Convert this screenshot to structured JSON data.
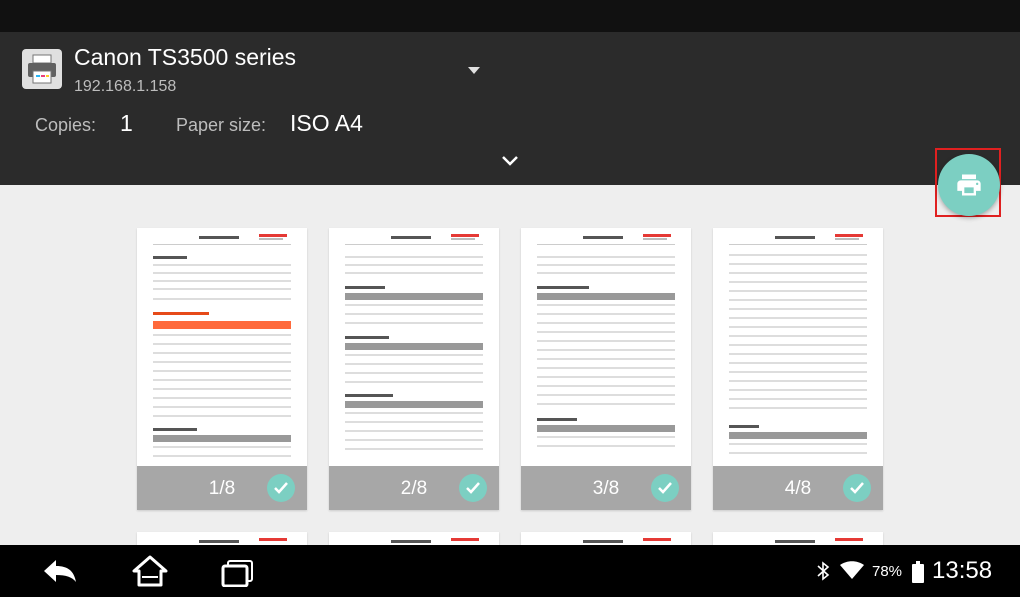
{
  "printer": {
    "name": "Canon TS3500 series",
    "ip": "192.168.1.158"
  },
  "settings": {
    "copies_label": "Copies:",
    "copies_value": "1",
    "paper_size_label": "Paper size:",
    "paper_size_value": "ISO A4"
  },
  "pages": [
    {
      "label": "1/8",
      "selected": true
    },
    {
      "label": "2/8",
      "selected": true
    },
    {
      "label": "3/8",
      "selected": true
    },
    {
      "label": "4/8",
      "selected": true
    }
  ],
  "status_bar": {
    "battery": "78%",
    "time": "13:58"
  },
  "colors": {
    "accent": "#7ccfc2",
    "header_bg": "#2b2b2b",
    "highlight_frame": "#e02020",
    "report_orange": "#ff6a3c"
  },
  "icons": {
    "printer": "printer-icon",
    "dropdown": "chevron-down-icon",
    "expand": "chevron-down-icon",
    "fab": "print-icon",
    "selected": "check-icon",
    "back": "back-icon",
    "home": "home-icon",
    "recent": "recent-apps-icon"
  }
}
